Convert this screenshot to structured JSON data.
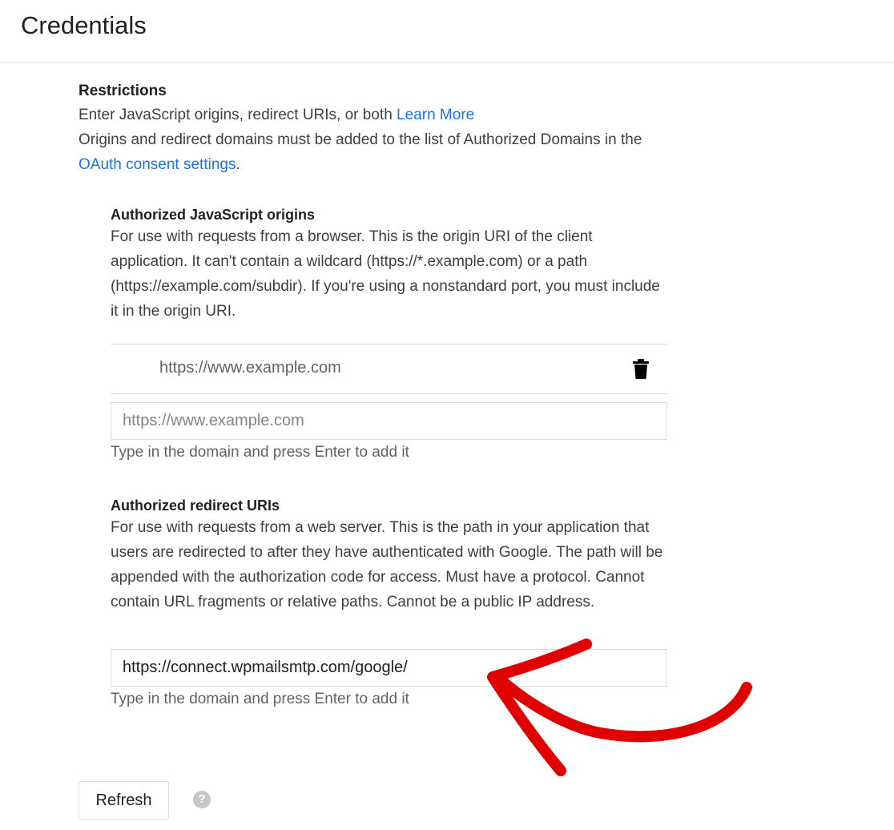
{
  "header": {
    "title": "Credentials"
  },
  "restrictions": {
    "heading": "Restrictions",
    "intro_text": "Enter JavaScript origins, redirect URIs, or both",
    "learn_more_link": "Learn More",
    "domains_text_before": "Origins and redirect domains must be added to the list of Authorized Domains in the",
    "oauth_link": "OAuth consent settings",
    "domains_text_after": "."
  },
  "js_origins": {
    "heading": "Authorized JavaScript origins",
    "description": "For use with requests from a browser. This is the origin URI of the client application. It can't contain a wildcard (https://*.example.com) or a path (https://example.com/subdir). If you're using a nonstandard port, you must include it in the origin URI.",
    "items": [
      {
        "value": "https://www.example.com",
        "delete_icon": "trash-icon"
      }
    ],
    "input_placeholder": "https://www.example.com",
    "input_value": "",
    "hint": "Type in the domain and press Enter to add it"
  },
  "redirect_uris": {
    "heading": "Authorized redirect URIs",
    "description": "For use with requests from a web server. This is the path in your application that users are redirected to after they have authenticated with Google. The path will be appended with the authorization code for access. Must have a protocol. Cannot contain URL fragments or relative paths. Cannot be a public IP address.",
    "input_value": "https://connect.wpmailsmtp.com/google/",
    "hint": "Type in the domain and press Enter to add it"
  },
  "footer": {
    "refresh_label": "Refresh",
    "help_icon": "help-icon",
    "help_glyph": "?"
  },
  "colors": {
    "link": "#1a73e8",
    "annotation_arrow": "#e00000"
  }
}
